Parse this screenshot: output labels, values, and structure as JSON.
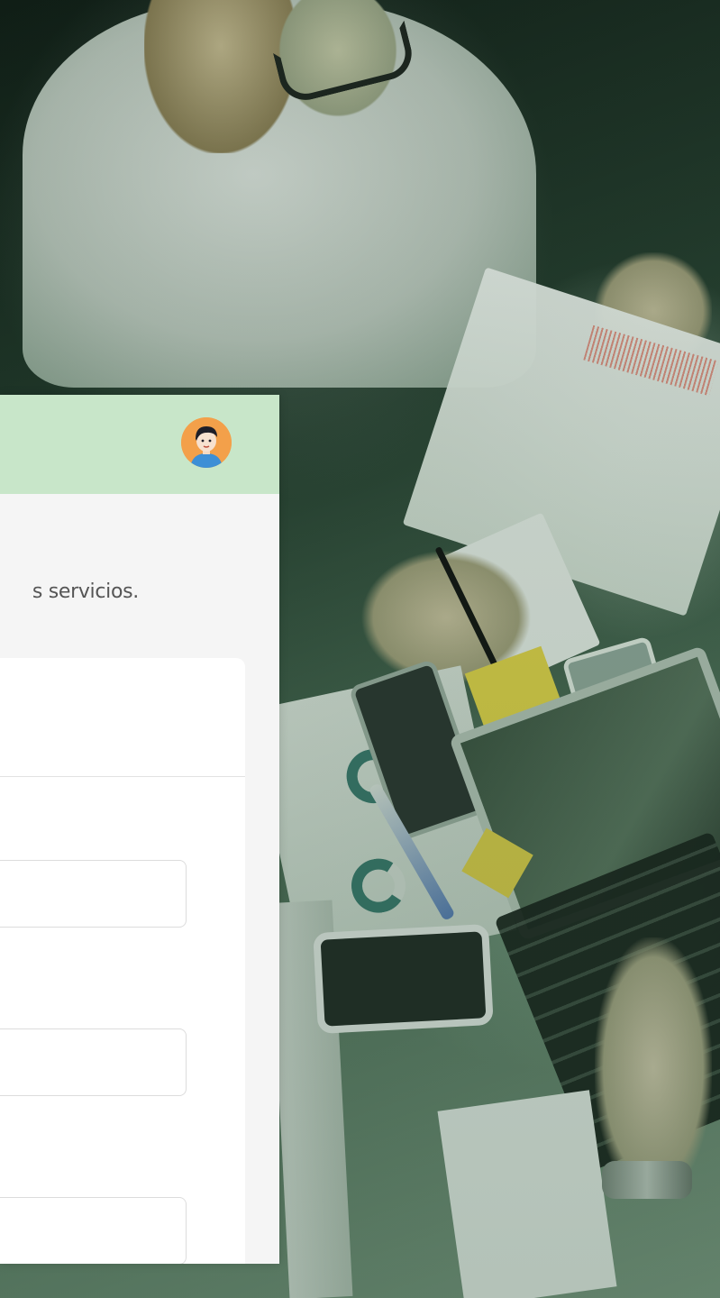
{
  "background": {
    "description_icon": "office-teamwork-photo",
    "tint": "#2f5a3c"
  },
  "app": {
    "header": {
      "background_color": "#c8e6c9",
      "avatar_icon": "user-avatar-icon"
    },
    "intro_text": "s servicios.",
    "form": {
      "fields": [
        {
          "value": ""
        },
        {
          "value": ""
        },
        {
          "value": ""
        }
      ]
    }
  }
}
